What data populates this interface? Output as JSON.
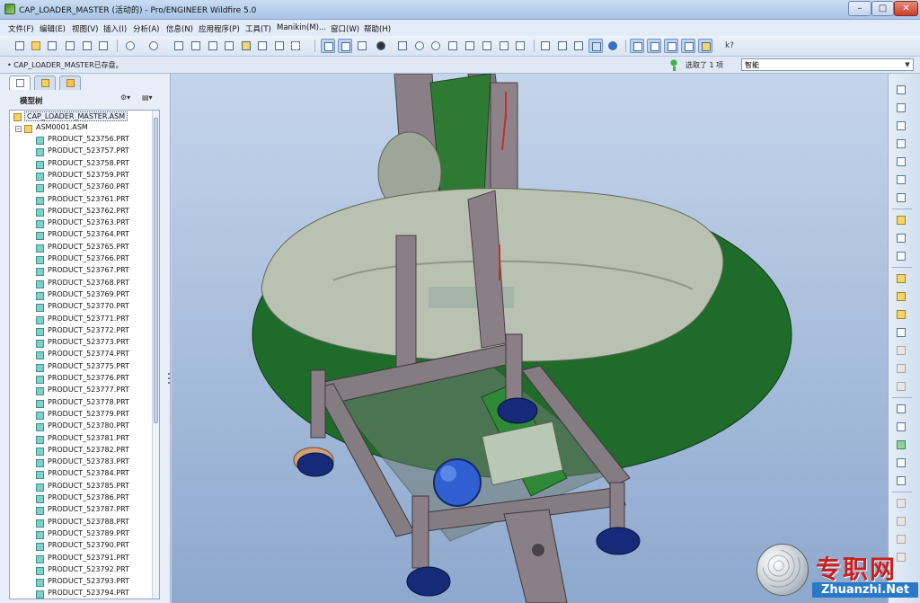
{
  "window": {
    "title": "CAP_LOADER_MASTER (活动的) - Pro/ENGINEER Wildfire 5.0",
    "minimize": "–",
    "maximize": "□",
    "close": "✕"
  },
  "menu": [
    "文件(F)",
    "编辑(E)",
    "视图(V)",
    "插入(I)",
    "分析(A)",
    "信息(N)",
    "应用程序(P)",
    "工具(T)",
    "Manikin(M)...",
    "窗口(W)",
    "帮助(H)"
  ],
  "status": {
    "message": "• CAP_LOADER_MASTER已存盘。",
    "selection": "选取了 1 项",
    "filter": "智能"
  },
  "model_tree": {
    "title": "模型树",
    "root": "CAP_LOADER_MASTER.ASM",
    "sub_assembly": "ASM0001.ASM",
    "parts": [
      "PRODUCT_523756.PRT",
      "PRODUCT_523757.PRT",
      "PRODUCT_523758.PRT",
      "PRODUCT_523759.PRT",
      "PRODUCT_523760.PRT",
      "PRODUCT_523761.PRT",
      "PRODUCT_523762.PRT",
      "PRODUCT_523763.PRT",
      "PRODUCT_523764.PRT",
      "PRODUCT_523765.PRT",
      "PRODUCT_523766.PRT",
      "PRODUCT_523767.PRT",
      "PRODUCT_523768.PRT",
      "PRODUCT_523769.PRT",
      "PRODUCT_523770.PRT",
      "PRODUCT_523771.PRT",
      "PRODUCT_523772.PRT",
      "PRODUCT_523773.PRT",
      "PRODUCT_523774.PRT",
      "PRODUCT_523775.PRT",
      "PRODUCT_523776.PRT",
      "PRODUCT_523777.PRT",
      "PRODUCT_523778.PRT",
      "PRODUCT_523779.PRT",
      "PRODUCT_523780.PRT",
      "PRODUCT_523781.PRT",
      "PRODUCT_523782.PRT",
      "PRODUCT_523783.PRT",
      "PRODUCT_523784.PRT",
      "PRODUCT_523785.PRT",
      "PRODUCT_523786.PRT",
      "PRODUCT_523787.PRT",
      "PRODUCT_523788.PRT",
      "PRODUCT_523789.PRT",
      "PRODUCT_523790.PRT",
      "PRODUCT_523791.PRT",
      "PRODUCT_523792.PRT",
      "PRODUCT_523793.PRT",
      "PRODUCT_523794.PRT"
    ]
  },
  "watermark": {
    "cn": "专职网",
    "en": "Zhuanzhi.Net"
  },
  "colors": {
    "viewport_top": "#c4d4eb",
    "viewport_bottom": "#8ea8ce",
    "disc_green": "#1f6b2a",
    "rim_gray": "#b9c2b1",
    "frame_gray": "#8a7f86",
    "wheel_blue": "#162a7a",
    "motor_blue": "#2f5fd0"
  }
}
